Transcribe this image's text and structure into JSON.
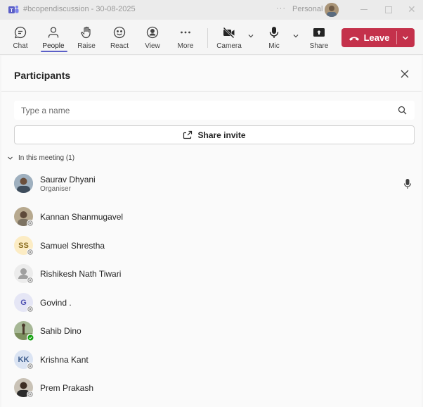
{
  "titlebar": {
    "title": "#bcopendiscussion - 30-08-2025",
    "more": "···",
    "account": "Personal"
  },
  "toolbar": {
    "buttons": [
      {
        "label": "Chat",
        "icon": "chat-icon"
      },
      {
        "label": "People",
        "icon": "people-icon",
        "active": true
      },
      {
        "label": "Raise",
        "icon": "hand-icon"
      },
      {
        "label": "React",
        "icon": "smile-icon"
      },
      {
        "label": "View",
        "icon": "view-icon"
      },
      {
        "label": "More",
        "icon": "ellipsis-icon"
      },
      {
        "label": "Camera",
        "icon": "camera-off-icon"
      },
      {
        "label": "Mic",
        "icon": "mic-icon"
      },
      {
        "label": "Share",
        "icon": "share-screen-icon"
      }
    ],
    "leave_label": "Leave",
    "leave_color": "#c4314b",
    "accent_color": "#5b5fc7"
  },
  "participants": {
    "title": "Participants",
    "search_placeholder": "Type a name",
    "share_invite_label": "Share invite",
    "section_label": "In this meeting (1)",
    "organizer": {
      "name": "Saurav Dhyani",
      "role": "Organiser"
    },
    "others": [
      {
        "name": "Kannan Shanmugavel",
        "avatar": "photo",
        "status": "offline"
      },
      {
        "name": "Samuel Shrestha",
        "avatar": "initials",
        "initials": "SS",
        "status": "offline"
      },
      {
        "name": "Rishikesh Nath Tiwari",
        "avatar": "generic",
        "status": "offline"
      },
      {
        "name": "Govind .",
        "avatar": "initials",
        "initials": "G",
        "status": "offline"
      },
      {
        "name": "Sahib Dino",
        "avatar": "photo",
        "status": "available"
      },
      {
        "name": "Krishna Kant",
        "avatar": "initials",
        "initials": "KK",
        "status": "offline"
      },
      {
        "name": "Prem Prakash",
        "avatar": "photo",
        "status": "offline"
      }
    ]
  }
}
